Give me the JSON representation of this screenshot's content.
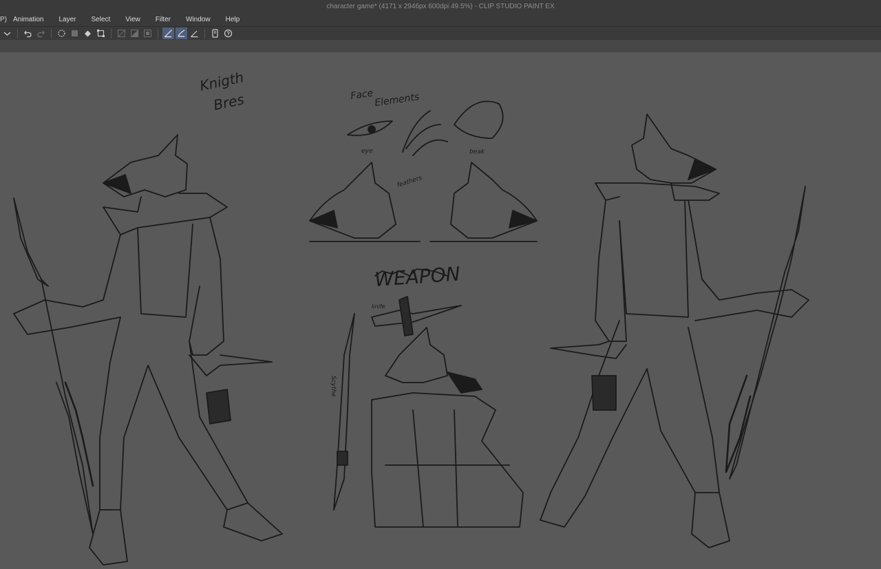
{
  "window": {
    "title": "character game* (4171 x 2946px 600dpi 49.5%)  - CLIP STUDIO PAINT EX"
  },
  "menubar": {
    "cut_label": "P)",
    "items": [
      "Animation",
      "Layer",
      "Select",
      "View",
      "Filter",
      "Window",
      "Help"
    ]
  },
  "toolbar": {
    "icons": [
      "undo-icon",
      "redo-icon",
      "loading-icon",
      "clear-icon",
      "fill-icon",
      "transform-icon",
      "rule-icon",
      "snap-ruler-icon",
      "snap-special-icon",
      "snap-grid-icon",
      "pen-stroke-icon",
      "brush-stroke-icon",
      "angle-icon",
      "device-icon",
      "help-icon"
    ]
  },
  "canvas": {
    "notes": {
      "title_line1": "Knigth",
      "title_line2": "Bres",
      "face_line1": "Face",
      "face_line2": "Elements",
      "eye": "eye",
      "beak": "beak",
      "feathers": "feathers",
      "weapon": "WEAPON",
      "knife": "knife",
      "scythe": "Scythe"
    }
  },
  "colors": {
    "chrome": "#3a3a3a",
    "canvas": "#595959",
    "ink": "#1b1b1b",
    "active_tool": "#4f5f7c"
  }
}
